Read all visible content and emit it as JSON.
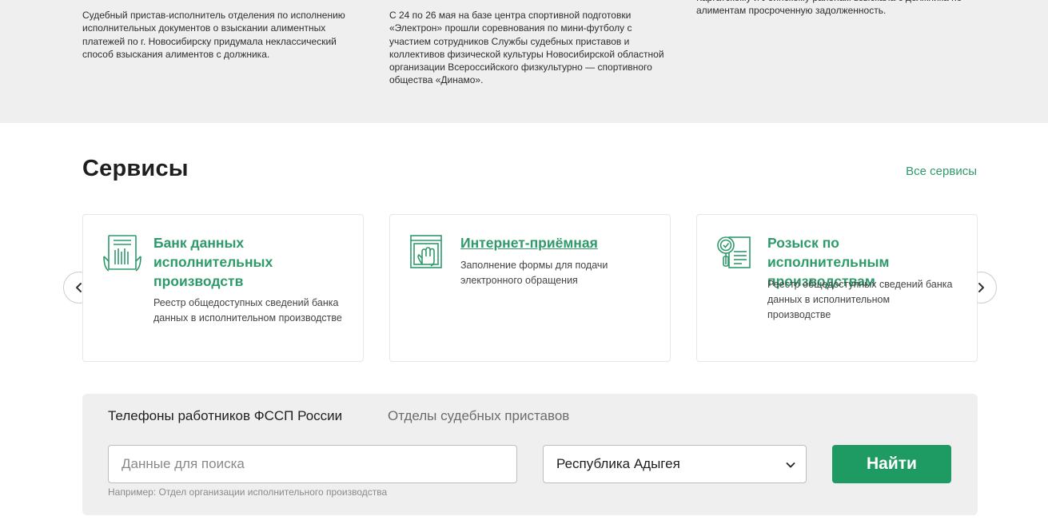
{
  "news": [
    {
      "text": "Судебный пристав-исполнитель отделения по исполнению исполнительных документов о взыскании алиментных платежей по г. Новосибирску придумала неклассический способ взыскания алиментов с должника."
    },
    {
      "text": "С 24 по 26 мая на базе центра спортивной подготовки «Электрон» прошли соревнования по мини-футболу с участием сотрудников Службы судебных приставов и коллективов физической культуры Новосибирской областной организации Всероссийского физкультурно — спортивного общества «Динамо»."
    },
    {
      "text": "Каргатскому и Убинскому районам взыскала с должника по алиментам просроченную задолженность."
    }
  ],
  "services": {
    "title": "Сервисы",
    "all_link": "Все сервисы",
    "cards": [
      {
        "icon": "document-database-icon",
        "title": "Банк данных исполнительных производств",
        "desc": "Реестр общедоступных сведений банка данных в исполнительном производстве"
      },
      {
        "icon": "online-reception-icon",
        "title": "Интернет-приёмная",
        "desc": "Заполнение формы для подачи электронного обращения"
      },
      {
        "icon": "search-document-icon",
        "title": "Розыск по исполнительным производствам",
        "desc": "Реестр общедоступных сведений банка данных в исполнительном производстве"
      }
    ]
  },
  "search": {
    "tabs": [
      "Телефоны работников ФССП России",
      "Отделы судебных приставов"
    ],
    "placeholder": "Данные для поиска",
    "region": "Республика Адыгея",
    "button": "Найти",
    "hint": "Например: Отдел организации исполнительного производства"
  },
  "colors": {
    "accent": "#2e9a6a",
    "button": "#1e9b63",
    "panel": "#eeefee"
  }
}
